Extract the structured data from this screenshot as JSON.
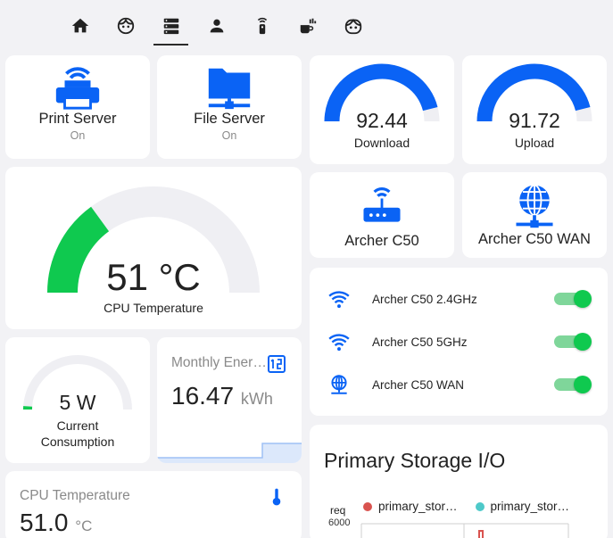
{
  "tabs": [
    {
      "icon": "home-icon",
      "active": false
    },
    {
      "icon": "face-icon",
      "active": false
    },
    {
      "icon": "server-icon",
      "active": true
    },
    {
      "icon": "person-icon",
      "active": false
    },
    {
      "icon": "remote-icon",
      "active": false
    },
    {
      "icon": "coffee-icon",
      "active": false
    },
    {
      "icon": "robot-icon",
      "active": false
    }
  ],
  "colors": {
    "accent": "#0a63f5",
    "green": "#0fc94f",
    "track": "#efeff3"
  },
  "print_server": {
    "name": "Print Server",
    "state": "On"
  },
  "file_server": {
    "name": "File Server",
    "state": "On"
  },
  "download": {
    "value": "92.44",
    "label": "Download",
    "level": 0.92
  },
  "upload": {
    "value": "91.72",
    "label": "Upload",
    "level": 0.92
  },
  "cpu_gauge": {
    "value": "51 °C",
    "label": "CPU Temperature",
    "level": 0.3
  },
  "archer": {
    "name": "Archer C50"
  },
  "archer_wan": {
    "name": "Archer C50 WAN"
  },
  "switches": [
    {
      "label": "Archer C50 2.4GHz",
      "icon": "wifi-icon",
      "on": true
    },
    {
      "label": "Archer C50 5GHz",
      "icon": "wifi-icon",
      "on": true
    },
    {
      "label": "Archer C50 WAN",
      "icon": "globe-network-icon",
      "on": true
    }
  ],
  "consumption": {
    "value": "5 W",
    "label_line1": "Current",
    "label_line2": "Consumption",
    "level": 0.02
  },
  "monthly": {
    "title": "Monthly Ener…",
    "value": "16.47",
    "unit": "kWh"
  },
  "cpu_sensor": {
    "title": "CPU Temperature",
    "value": "51.0",
    "unit": "°C"
  },
  "storage": {
    "title": "Primary Storage I/O"
  },
  "chart_data": {
    "type": "line",
    "ylabel": "req",
    "yticks": [
      "6000"
    ],
    "series": [
      {
        "name": "primary_stor…",
        "color": "#d9534f"
      },
      {
        "name": "primary_stor…",
        "color": "#4ec9c9"
      }
    ]
  }
}
